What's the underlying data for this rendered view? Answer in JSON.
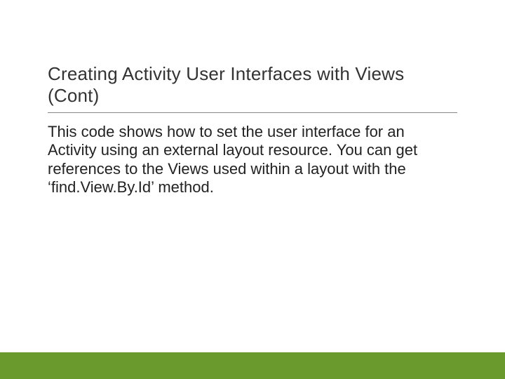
{
  "slide": {
    "title": "Creating Activity User Interfaces with Views (Cont)",
    "body": "This code shows how to set the user interface for an Activity using an external layout resource.  You can get references to the Views used within a layout with the ‘find.View.By.Id’ method."
  },
  "colors": {
    "accent": "#6a9a2d"
  }
}
